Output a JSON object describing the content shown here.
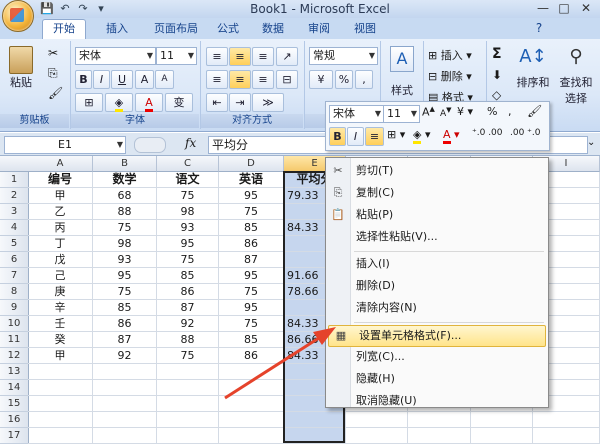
{
  "window": {
    "title": "Book1 - Microsoft Excel",
    "controls": [
      "—",
      "□",
      "✕"
    ]
  },
  "qat": [
    "💾",
    "↶",
    "↷",
    "▾"
  ],
  "tabs": [
    "开始",
    "插入",
    "页面布局",
    "公式",
    "数据",
    "审阅",
    "视图"
  ],
  "active_tab": "开始",
  "ribbon": {
    "clipboard": {
      "label": "剪贴板",
      "paste": "粘贴"
    },
    "font": {
      "label": "字体",
      "name": "宋体",
      "size": "11",
      "bold": "B",
      "italic": "I",
      "underline": "U",
      "grow": "A",
      "shrink": "A",
      "wen": "变"
    },
    "alignment": {
      "label": "对齐方式"
    },
    "number": {
      "label": "数字",
      "format": "常规",
      "percent": "%",
      "comma": ","
    },
    "styles": {
      "label": "样式",
      "styles_btn": "样式"
    },
    "cells": {
      "label": "单元格",
      "insert": "插入",
      "delete": "删除",
      "format": "格式"
    },
    "editing": {
      "label": "编辑",
      "sigma": "Σ",
      "sort": "排序和",
      "sort2": "筛选",
      "find": "查找和",
      "find2": "选择"
    }
  },
  "formula_bar": {
    "name_box": "E1",
    "fx": "fx",
    "content": "平均分"
  },
  "columns": [
    "A",
    "B",
    "C",
    "D",
    "E",
    "F",
    "G",
    "H",
    "I"
  ],
  "rows": [
    {
      "n": "1",
      "cells": [
        "编号",
        "数学",
        "语文",
        "英语",
        "平均分"
      ]
    },
    {
      "n": "2",
      "cells": [
        "甲",
        "68",
        "75",
        "95",
        "79.33"
      ]
    },
    {
      "n": "3",
      "cells": [
        "乙",
        "88",
        "98",
        "75",
        ""
      ]
    },
    {
      "n": "4",
      "cells": [
        "丙",
        "75",
        "93",
        "85",
        "84.33"
      ]
    },
    {
      "n": "5",
      "cells": [
        "丁",
        "98",
        "95",
        "86",
        ""
      ]
    },
    {
      "n": "6",
      "cells": [
        "戊",
        "93",
        "75",
        "87",
        ""
      ]
    },
    {
      "n": "7",
      "cells": [
        "己",
        "95",
        "85",
        "95",
        "91.66"
      ]
    },
    {
      "n": "8",
      "cells": [
        "庚",
        "75",
        "86",
        "75",
        "78.66"
      ]
    },
    {
      "n": "9",
      "cells": [
        "辛",
        "85",
        "87",
        "95",
        ""
      ]
    },
    {
      "n": "10",
      "cells": [
        "壬",
        "86",
        "92",
        "75",
        "84.33"
      ]
    },
    {
      "n": "11",
      "cells": [
        "癸",
        "87",
        "88",
        "85",
        "86.66"
      ]
    },
    {
      "n": "12",
      "cells": [
        "甲",
        "92",
        "75",
        "86",
        "84.33"
      ]
    },
    {
      "n": "13",
      "cells": [
        "",
        "",
        "",
        "",
        ""
      ]
    },
    {
      "n": "14",
      "cells": [
        "",
        "",
        "",
        "",
        ""
      ]
    },
    {
      "n": "15",
      "cells": [
        "",
        "",
        "",
        "",
        ""
      ]
    },
    {
      "n": "16",
      "cells": [
        "",
        "",
        "",
        "",
        ""
      ]
    },
    {
      "n": "17",
      "cells": [
        "",
        "",
        "",
        "",
        ""
      ]
    }
  ],
  "mini_toolbar": {
    "font": "宋体",
    "size": "11",
    "bold": "B",
    "italic": "I",
    "percent": "%",
    "comma": ","
  },
  "context_menu": [
    {
      "icon": "✂",
      "label": "剪切(T)"
    },
    {
      "icon": "⎘",
      "label": "复制(C)"
    },
    {
      "icon": "📋",
      "label": "粘贴(P)"
    },
    {
      "icon": "",
      "label": "选择性粘贴(V)..."
    },
    {
      "sep": true
    },
    {
      "icon": "",
      "label": "插入(I)"
    },
    {
      "icon": "",
      "label": "删除(D)"
    },
    {
      "icon": "",
      "label": "清除内容(N)"
    },
    {
      "sep": true
    },
    {
      "icon": "▦",
      "label": "设置单元格格式(F)...",
      "highlight": true
    },
    {
      "icon": "",
      "label": "列宽(C)..."
    },
    {
      "icon": "",
      "label": "隐藏(H)"
    },
    {
      "icon": "",
      "label": "取消隐藏(U)"
    }
  ],
  "colors": {
    "arrow": "#e5432b",
    "highlight": "#ffe48a",
    "selection": "#c6d6ee"
  }
}
